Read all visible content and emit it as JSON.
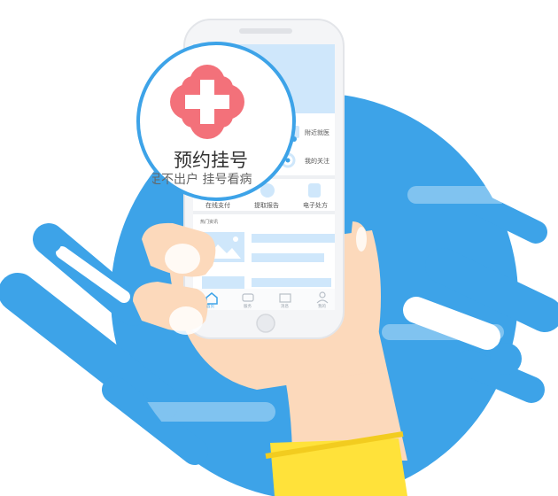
{
  "colors": {
    "primary_blue": "#3da3e8",
    "light_blue": "#cfe7fb",
    "skin": "#fcd9bb",
    "skin_shadow": "#f1bf98",
    "sleeve": "#ffe23a",
    "cross_red": "#f3717a",
    "phone_white": "#f4f5f7"
  },
  "magnifier": {
    "title": "预约挂号",
    "subtitle": "足不出户 挂号看病",
    "icon": "hospital-cross-icon"
  },
  "phone": {
    "quick_links": [
      {
        "label": "附近就医",
        "icon": "location-pin-icon"
      },
      {
        "label": "我的关注",
        "icon": "target-icon"
      }
    ],
    "services": [
      {
        "label": "在线支付",
        "icon": "wallet-icon"
      },
      {
        "label": "提取报告",
        "icon": "report-icon"
      },
      {
        "label": "电子处方",
        "icon": "prescription-icon"
      }
    ],
    "news_header": "热门资讯",
    "nav": [
      {
        "label": "首页",
        "icon": "home-icon",
        "active": true
      },
      {
        "label": "服务",
        "icon": "chat-icon",
        "active": false
      },
      {
        "label": "消息",
        "icon": "mail-icon",
        "active": false
      },
      {
        "label": "我的",
        "icon": "user-icon",
        "active": false
      }
    ]
  }
}
